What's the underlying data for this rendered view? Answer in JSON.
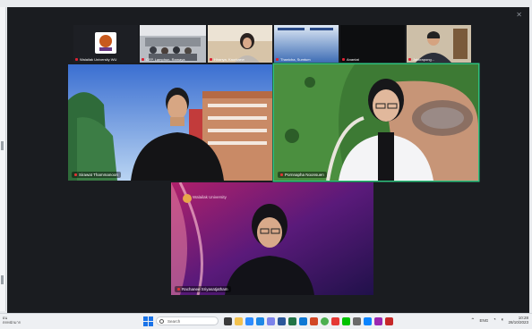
{
  "meeting": {
    "thumbnails": [
      {
        "id": "org",
        "label": "Walailak University WU"
      },
      {
        "id": "group",
        "label": "CFP, Lamphun, Ramaya"
      },
      {
        "id": "woman",
        "label": "Hiranya, Kaurkaew"
      },
      {
        "id": "slide",
        "label": "Thanicha, Sumtum"
      },
      {
        "id": "blank",
        "label": "Anantat"
      },
      {
        "id": "man2",
        "label": "Jakkrapong..."
      }
    ],
    "tiles": [
      {
        "id": "speaker-1",
        "label": "Sirawat Thammanoon"
      },
      {
        "id": "speaker-2",
        "label": "Pornnapha Noonsuen"
      },
      {
        "id": "speaker-3",
        "label": "Rachanee Sriyasatjatham"
      }
    ],
    "bg_text": "Walailak University"
  },
  "taskbar": {
    "left_text_line1": "ฝน",
    "left_text_line2": "ตกหนักมาก",
    "search_placeholder": "Search",
    "tray_lang": "ENG",
    "tray_time": "10:28",
    "tray_date": "28/10/2023"
  },
  "colors": {
    "active_speaker": "#2ec27e",
    "meeting_bg": "#1a1c20"
  }
}
